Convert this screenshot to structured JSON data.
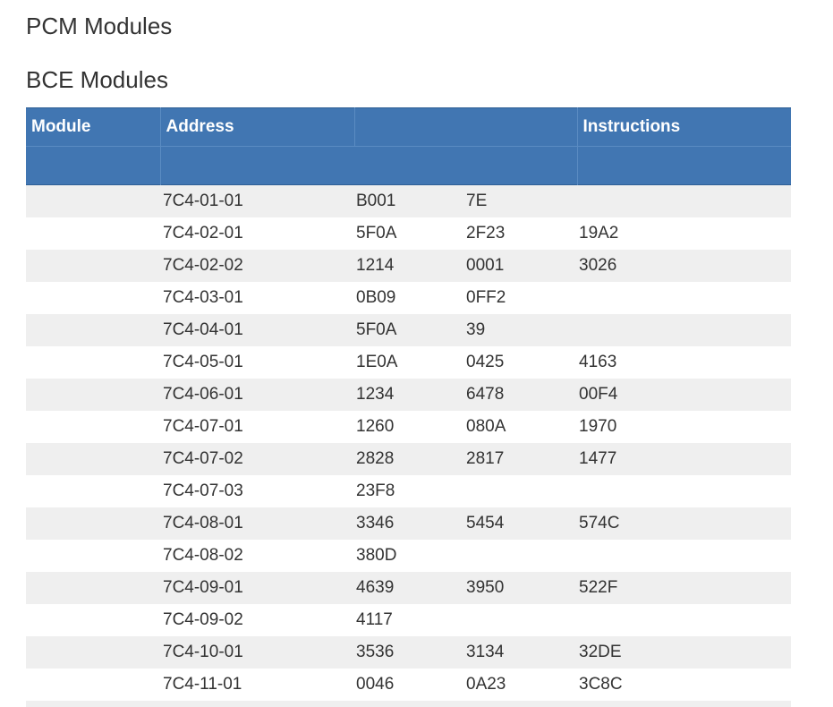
{
  "headings": {
    "pcm": "PCM Modules",
    "bce": "BCE Modules"
  },
  "table": {
    "columns": {
      "module": "Module",
      "address": "Address",
      "blank": "",
      "instructions": "Instructions"
    },
    "rows": [
      {
        "module": "",
        "address": "7C4-01-01",
        "i1": "B001",
        "i2": "7E",
        "i3": ""
      },
      {
        "module": "",
        "address": "7C4-02-01",
        "i1": "5F0A",
        "i2": "2F23",
        "i3": "19A2"
      },
      {
        "module": "",
        "address": "7C4-02-02",
        "i1": "1214",
        "i2": "0001",
        "i3": "3026"
      },
      {
        "module": "",
        "address": "7C4-03-01",
        "i1": "0B09",
        "i2": "0FF2",
        "i3": ""
      },
      {
        "module": "",
        "address": "7C4-04-01",
        "i1": "5F0A",
        "i2": "39",
        "i3": ""
      },
      {
        "module": "",
        "address": "7C4-05-01",
        "i1": "1E0A",
        "i2": "0425",
        "i3": "4163"
      },
      {
        "module": "",
        "address": "7C4-06-01",
        "i1": "1234",
        "i2": "6478",
        "i3": "00F4"
      },
      {
        "module": "",
        "address": "7C4-07-01",
        "i1": "1260",
        "i2": "080A",
        "i3": "1970"
      },
      {
        "module": "",
        "address": "7C4-07-02",
        "i1": "2828",
        "i2": "2817",
        "i3": "1477"
      },
      {
        "module": "",
        "address": "7C4-07-03",
        "i1": "23F8",
        "i2": "",
        "i3": ""
      },
      {
        "module": "",
        "address": "7C4-08-01",
        "i1": "3346",
        "i2": "5454",
        "i3": "574C"
      },
      {
        "module": "",
        "address": "7C4-08-02",
        "i1": "380D",
        "i2": "",
        "i3": ""
      },
      {
        "module": "",
        "address": "7C4-09-01",
        "i1": "4639",
        "i2": "3950",
        "i3": "522F"
      },
      {
        "module": "",
        "address": "7C4-09-02",
        "i1": "4117",
        "i2": "",
        "i3": ""
      },
      {
        "module": "",
        "address": "7C4-10-01",
        "i1": "3536",
        "i2": "3134",
        "i3": "32DE"
      },
      {
        "module": "",
        "address": "7C4-11-01",
        "i1": "0046",
        "i2": "0A23",
        "i3": "3C8C"
      },
      {
        "module": "",
        "address": "",
        "i1": "",
        "i2": "",
        "i3": ""
      }
    ]
  }
}
